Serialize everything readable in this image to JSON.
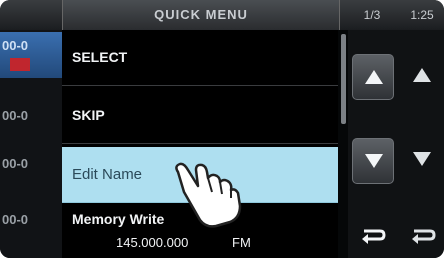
{
  "header": {
    "title": "QUICK MENU",
    "status_a": "1/3",
    "status_b": "1:25"
  },
  "left_list": {
    "rows": [
      "00-0",
      "00-0",
      "00-0",
      "00-0"
    ]
  },
  "menu": {
    "items": [
      {
        "label": "SELECT"
      },
      {
        "label": "SKIP"
      },
      {
        "label": "Edit Name"
      },
      {
        "label": "Memory Write",
        "frequency": "145.000.000",
        "mode": "FM"
      }
    ],
    "selected_index": 2
  },
  "buttons": {
    "up_icon": "triangle-up-icon",
    "down_icon": "triangle-down-icon",
    "return_icon": "return-arrow-icon"
  },
  "colors": {
    "selected_bg": "#aedff0",
    "menu_bg": "#000000",
    "accent_blue": "#3a6fb0"
  }
}
